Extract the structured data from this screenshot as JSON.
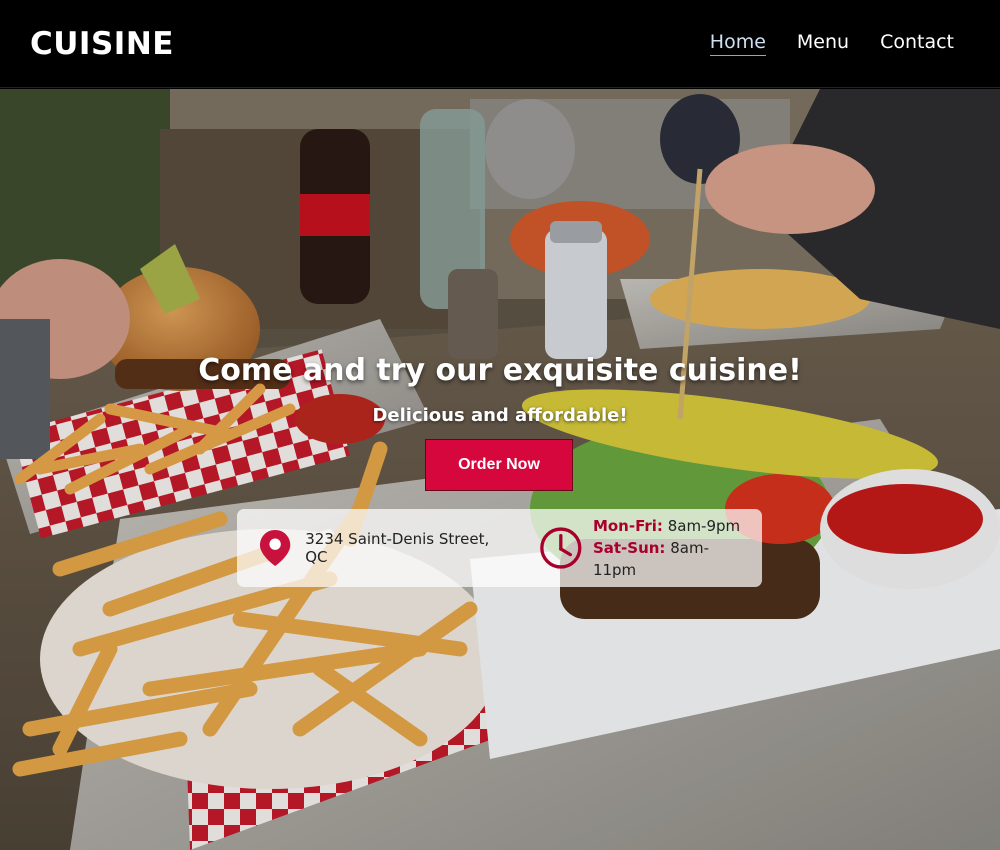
{
  "brand": "CUISINE",
  "nav": {
    "items": [
      {
        "label": "Home",
        "active": true
      },
      {
        "label": "Menu",
        "active": false
      },
      {
        "label": "Contact",
        "active": false
      }
    ]
  },
  "hero": {
    "headline": "Come and try our exquisite cuisine!",
    "subheadline": "Delicious and affordable!",
    "cta_label": "Order Now",
    "background": "photo of burgers, fries, pickle and ketchup on trays at an outdoor wooden table"
  },
  "info": {
    "address": "3234 Saint-Denis Street, QC",
    "hours": [
      {
        "days": "Mon-Fri:",
        "time": "8am-9pm"
      },
      {
        "days": "Sat-Sun:",
        "time": "8am-11pm"
      }
    ]
  },
  "icons": {
    "location": "location-pin-icon",
    "clock": "clock-icon"
  },
  "colors": {
    "accent": "#d6073c",
    "accent_dark": "#a8002b",
    "nav_bg": "#000000"
  }
}
